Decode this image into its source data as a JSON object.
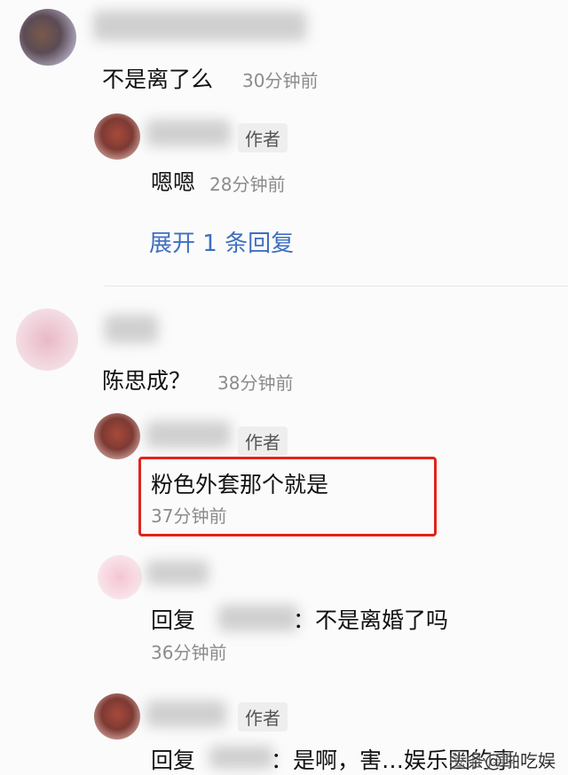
{
  "comments": [
    {
      "text": "不是离了么",
      "time": "30分钟前",
      "replies": [
        {
          "author_badge": "作者",
          "text": "嗯嗯",
          "time": "28分钟前"
        }
      ],
      "expand_label": "展开 1 条回复"
    },
    {
      "text": "陈思成？",
      "time": "38分钟前",
      "replies": [
        {
          "author_badge": "作者",
          "text": "粉色外套那个就是",
          "time": "37分钟前"
        },
        {
          "reply_prefix": "回复",
          "text": "：不是离婚了吗",
          "time": "36分钟前"
        },
        {
          "author_badge": "作者",
          "reply_prefix": "回复",
          "text": "：是啊，害…娱乐圈的事"
        }
      ]
    }
  ],
  "watermark": "头条@啪吃娱",
  "colors": {
    "link": "#3e6fc0",
    "highlight": "#e2231a",
    "time": "#8c8c8c"
  }
}
